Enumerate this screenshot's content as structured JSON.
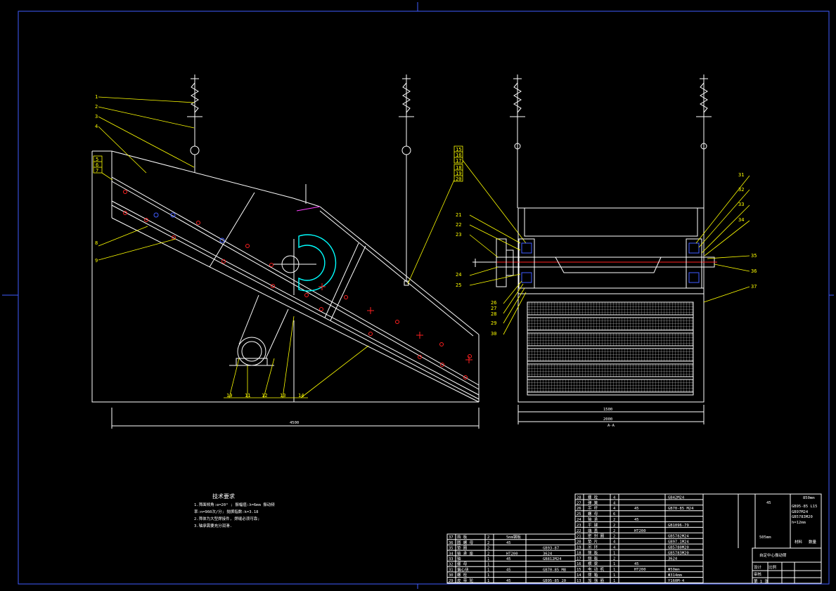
{
  "drawing": {
    "colors": {
      "background": "#000000",
      "frame": "#3f5bff",
      "outline": "#ffffff",
      "leader": "#ffff00",
      "accent_cyan": "#00ffff",
      "accent_red": "#ff2020",
      "accent_magenta": "#ff40ff"
    },
    "side_view": {
      "callouts_left": [
        "1",
        "2",
        "3",
        "4",
        "5",
        "6",
        "7",
        "8",
        "9"
      ],
      "callouts_bottom": [
        "10",
        "11",
        "12",
        "13",
        "14"
      ],
      "callouts_center": [
        "15",
        "16",
        "17",
        "18",
        "19",
        "20"
      ],
      "overall_length": "4500"
    },
    "end_view": {
      "callouts_left": [
        "21",
        "22",
        "23",
        "24",
        "25",
        "26",
        "27",
        "28",
        "29",
        "30"
      ],
      "callouts_right": [
        "31",
        "32",
        "33",
        "34",
        "35",
        "36",
        "37"
      ],
      "width_inner": "1500",
      "width_outer": "2000",
      "section_label": "A-A"
    },
    "tech_notes": {
      "title": "技术要求",
      "lines": [
        "1.筛面倾角:α=20°  ; 振幅值:λ=6mm 振动频",
        "率:n=960次/分; 抛掷指数:k=3.18",
        "2.筛体为大型焊接件, 焊缝必须可靠;",
        "3.轴承需要充分润滑."
      ]
    },
    "bom_left": {
      "rows": [
        {
          "no": "37",
          "name": "挡 板",
          "qty": "2",
          "mat": "5mm钢板",
          "std": ""
        },
        {
          "no": "36",
          "name": "圆 螺 母",
          "qty": "2",
          "mat": "45",
          "std": ""
        },
        {
          "no": "35",
          "name": "垫 圈",
          "qty": "2",
          "mat": "",
          "std": "GB93-87"
        },
        {
          "no": "34",
          "name": "轴 承 座",
          "qty": "2",
          "mat": "HT200",
          "std": "3624"
        },
        {
          "no": "33",
          "name": "轴",
          "qty": "1",
          "mat": "45",
          "std": "GB812M24"
        },
        {
          "no": "32",
          "name": "螺 母",
          "qty": "1",
          "mat": "",
          "std": ""
        },
        {
          "no": "31",
          "name": "偏心块",
          "qty": "1",
          "mat": "45",
          "std": "GB70-85 M8"
        },
        {
          "no": "30",
          "name": "螺 栓",
          "qty": "1",
          "mat": "",
          "std": ""
        },
        {
          "no": "29",
          "name": "皮 带 轮",
          "qty": "1",
          "mat": "45",
          "std": "GB95-85 20"
        }
      ]
    },
    "bom_right": {
      "rows": [
        {
          "no": "28",
          "name": "螺 栓",
          "qty": "4",
          "mat": "",
          "std": "GB42M24"
        },
        {
          "no": "27",
          "name": "弹 簧",
          "qty": "4",
          "mat": "",
          "std": ""
        },
        {
          "no": "26",
          "name": "吊 杆",
          "qty": "4",
          "mat": "45",
          "std": "GB70-85 M24"
        },
        {
          "no": "25",
          "name": "螺 母",
          "qty": "6",
          "mat": "",
          "std": ""
        },
        {
          "no": "24",
          "name": "轴 承",
          "qty": "2",
          "mat": "45",
          "std": ""
        },
        {
          "no": "23",
          "name": "平 键",
          "qty": "2",
          "mat": "",
          "std": "GB1096-79"
        },
        {
          "no": "22",
          "name": "端 盖",
          "qty": "2",
          "mat": "HT200",
          "std": ""
        },
        {
          "no": "21",
          "name": "密 封 圈",
          "qty": "2",
          "mat": "",
          "std": "GB5782M24"
        },
        {
          "no": "20",
          "name": "垫 片",
          "qty": "4",
          "mat": "",
          "std": "GB97.1M24"
        },
        {
          "no": "19",
          "name": "吊 环",
          "qty": "4",
          "mat": "",
          "std": "GB5780M20"
        },
        {
          "no": "18",
          "name": "筛 板",
          "qty": "1",
          "mat": "",
          "std": "GB5783M20"
        },
        {
          "no": "17",
          "name": "侧 板",
          "qty": "2",
          "mat": "",
          "std": "3624"
        },
        {
          "no": "16",
          "name": "横 梁",
          "qty": "1",
          "mat": "45",
          "std": ""
        },
        {
          "no": "15",
          "name": "电 动 机",
          "qty": "1",
          "mat": "HT200",
          "std": "Φ50mm"
        },
        {
          "no": "14",
          "name": "筛 箱",
          "qty": "1",
          "mat": "",
          "std": "Φ314mm"
        },
        {
          "no": "13",
          "name": "加 强 筋",
          "qty": "1",
          "mat": "",
          "std": "Y160M-4"
        }
      ]
    },
    "bom_far_right": {
      "spec_1": "850mm",
      "spec_2": "45",
      "spec_3": "GB95-85 L15",
      "spec_4": "GB97M24",
      "spec_5": "GB5783M20",
      "spec_6": "h=12mm",
      "spec_7": "505mm",
      "mark_1": "材料",
      "mark_2": "数量"
    },
    "title_block": {
      "drawing_title": "自定中心振动筛",
      "scale_label": "比例",
      "sheet_label": "第 1 张",
      "designer_label": "设计",
      "checker_label": "审核"
    }
  }
}
